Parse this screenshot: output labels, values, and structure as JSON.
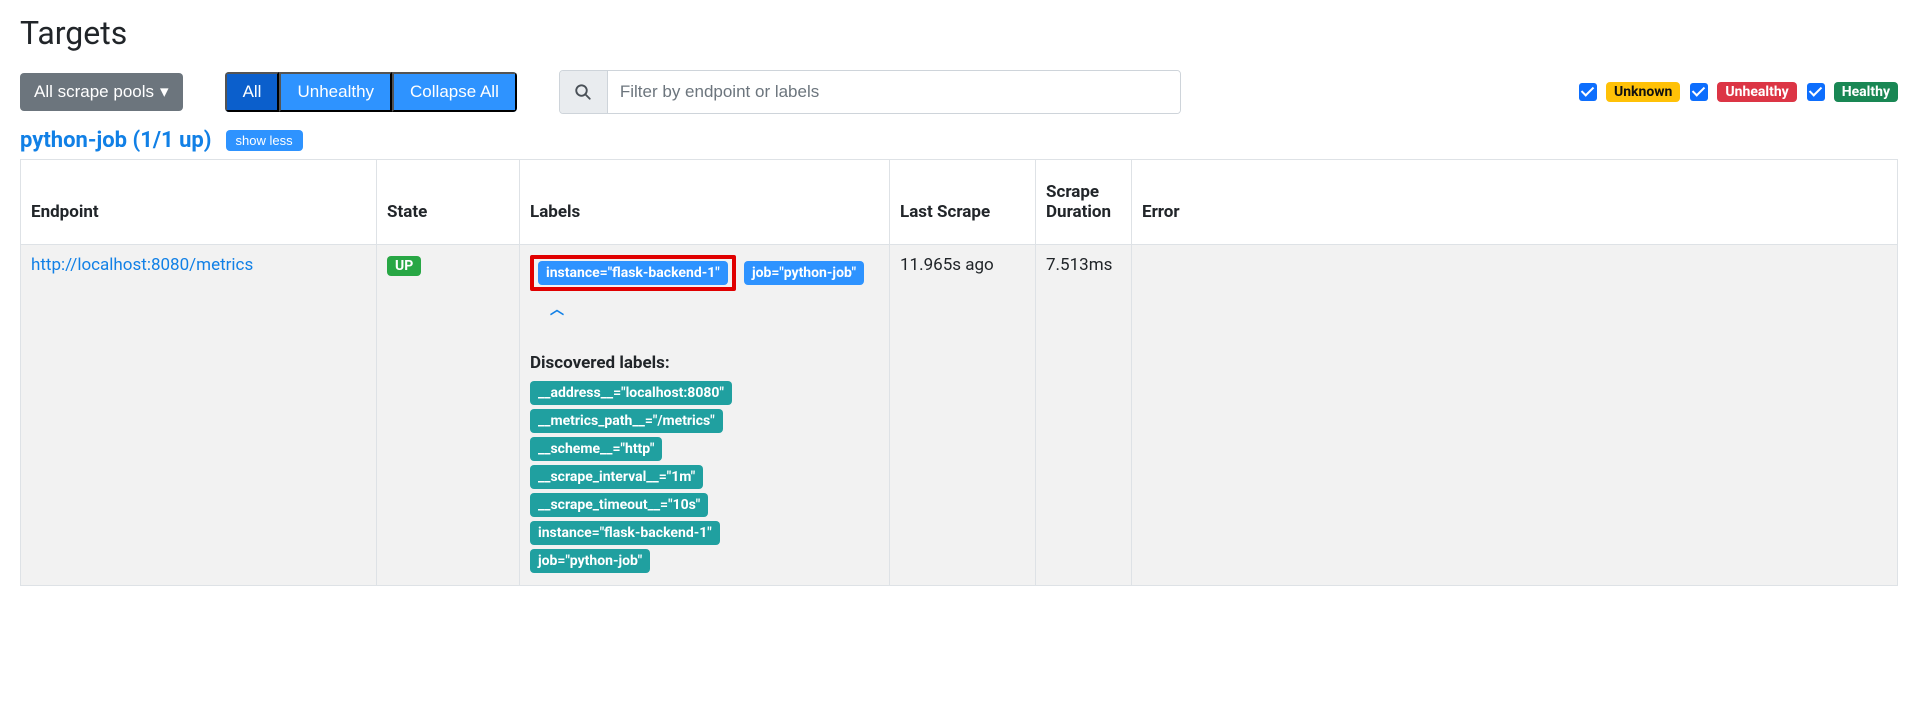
{
  "page": {
    "title": "Targets"
  },
  "toolbar": {
    "pools_label": "All scrape pools",
    "seg_all": "All",
    "seg_unhealthy": "Unhealthy",
    "seg_collapse": "Collapse All",
    "search_placeholder": "Filter by endpoint or labels"
  },
  "healthFilters": {
    "unknown": "Unknown",
    "unhealthy": "Unhealthy",
    "healthy": "Healthy"
  },
  "job": {
    "title": "python-job (1/1 up)",
    "toggle": "show less"
  },
  "table": {
    "headers": {
      "endpoint": "Endpoint",
      "state": "State",
      "labels": "Labels",
      "last": "Last Scrape",
      "duration": "Scrape Duration",
      "error": "Error"
    },
    "row": {
      "endpoint": "http://localhost:8080/metrics",
      "state": "UP",
      "last": "11.965s ago",
      "duration": "7.513ms",
      "labels": {
        "instance": "instance=\"flask-backend-1\"",
        "job": "job=\"python-job\""
      },
      "discovered_title": "Discovered labels:",
      "discovered": [
        "__address__=\"localhost:8080\"",
        "__metrics_path__=\"/metrics\"",
        "__scheme__=\"http\"",
        "__scrape_interval__=\"1m\"",
        "__scrape_timeout__=\"10s\"",
        "instance=\"flask-backend-1\"",
        "job=\"python-job\""
      ]
    }
  }
}
